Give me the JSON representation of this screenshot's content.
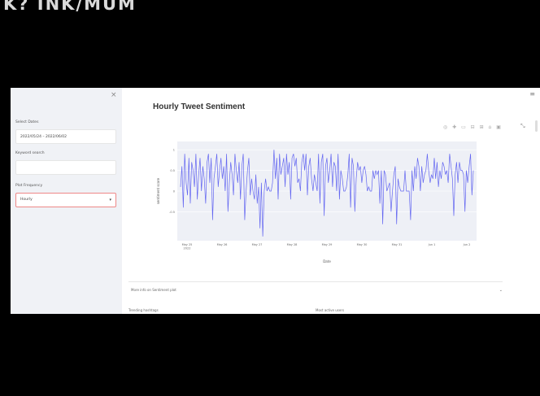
{
  "banner": {
    "text": "K? INK/MUM"
  },
  "sidebar": {
    "close_icon": "×",
    "date_label": "Select Dates",
    "date_value": "2022/05/24 – 2022/06/02",
    "keyword_label": "Keyword search",
    "keyword_value": "",
    "freq_label": "Plot Frequency",
    "freq_value": "Hourly"
  },
  "main": {
    "menu_icon": "≡",
    "title": "Hourly Tweet Sentiment",
    "toolbar": "◎ ✚ ▭ ⊟ ⊞ ⌂ ▣",
    "expand_icon": "⤡",
    "expander1": "More info on Sentiment plot",
    "expander_arrow": "⌄",
    "bottom_left": "Trending hashtags",
    "bottom_right": "Most active users"
  },
  "chart_data": {
    "type": "line",
    "ylabel": "sentiment score",
    "xlabel": "Date",
    "ylim": [
      -1.2,
      1.2
    ],
    "yticks": [
      "1",
      "0.5",
      "0",
      "-0.5"
    ],
    "xticks": [
      "May 25\n2022",
      "May 26",
      "May 27",
      "May 28",
      "May 29",
      "May 30",
      "May 31",
      "Jun 1",
      "Jun 2"
    ],
    "color": "#6366f1",
    "values": [
      0.1,
      0.6,
      -0.4,
      0.9,
      0.2,
      -0.1,
      0.8,
      -0.3,
      0.7,
      0.5,
      0.1,
      0.9,
      -0.2,
      0.4,
      0.8,
      0.0,
      0.6,
      0.3,
      -0.3,
      0.7,
      0.9,
      0.2,
      0.8,
      -0.7,
      0.3,
      0.6,
      0.9,
      0.1,
      0.5,
      0.8,
      0.3,
      0.6,
      0.0,
      0.9,
      -0.5,
      0.2,
      0.7,
      0.4,
      -0.1,
      0.9,
      0.5,
      0.2,
      0.7,
      -0.2,
      0.6,
      0.9,
      -0.7,
      0.0,
      0.5,
      0.8,
      -0.1,
      0.3,
      0.0,
      -0.2,
      0.4,
      -0.3,
      0.1,
      -0.9,
      0.2,
      -1.1,
      0.0,
      0.3,
      0.0,
      0.1,
      0.0,
      0.0,
      0.2,
      1.0,
      0.3,
      0.8,
      -0.2,
      0.9,
      0.4,
      0.6,
      0.8,
      0.1,
      0.9,
      0.4,
      0.7,
      -0.2,
      0.8,
      0.9,
      0.6,
      0.8,
      0.2,
      0.3,
      0.0,
      0.7,
      0.9,
      0.5,
      0.9,
      -0.1,
      0.6,
      0.8,
      0.3,
      0.0,
      0.4,
      0.2,
      0.0,
      0.9,
      -0.3,
      0.7,
      0.9,
      -0.6,
      0.6,
      0.8,
      0.2,
      0.5,
      0.9,
      0.1,
      0.7,
      0.6,
      0.0,
      0.9,
      -0.2,
      0.5,
      0.3,
      0.0,
      0.0,
      0.1,
      0.4,
      0.9,
      -0.4,
      0.8,
      0.6,
      -0.5,
      0.3,
      0.7,
      0.5,
      0.6,
      0.2,
      0.5,
      0.6,
      0.4,
      0.0,
      0.1,
      0.0,
      0.0,
      0.5,
      0.3,
      0.5,
      0.4,
      0.5,
      -0.3,
      0.5,
      -0.8,
      0.5,
      0.4,
      0.0,
      0.1,
      0.2,
      -0.5,
      0.0,
      0.4,
      0.6,
      -0.8,
      0.3,
      0.1,
      0.0,
      0.0,
      0.0,
      0.5,
      0.0,
      0.0,
      0.0,
      -0.7,
      0.5,
      0.0,
      0.6,
      0.3,
      0.8,
      0.6,
      0.0,
      0.6,
      0.2,
      0.4,
      0.5,
      0.9,
      0.5,
      0.2,
      0.4,
      0.3,
      0.8,
      0.3,
      0.7,
      0.1,
      0.5,
      0.3,
      0.7,
      0.6,
      0.4,
      0.5,
      0.2,
      0.9,
      0.6,
      0.3,
      -0.6,
      0.4,
      0.7,
      0.2,
      0.7,
      0.5,
      0.5,
      0.4,
      -0.5,
      0.5,
      0.2,
      0.6,
      0.9,
      -0.1,
      0.5
    ]
  }
}
